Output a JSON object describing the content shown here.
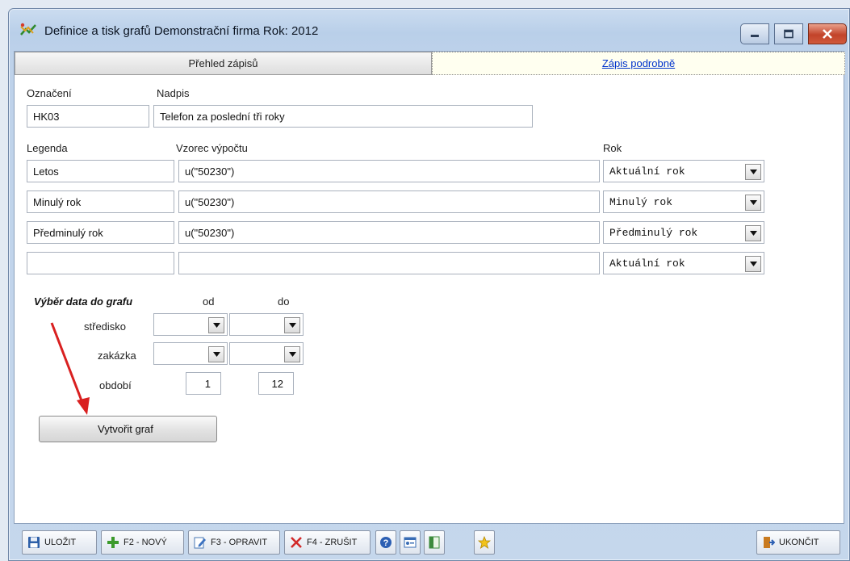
{
  "window": {
    "title": "Definice a tisk grafů  Demonstrační firma  Rok: 2012"
  },
  "tabs": [
    {
      "label": "Přehled zápisů",
      "active": false
    },
    {
      "label": "Zápis podrobně",
      "active": true
    }
  ],
  "form": {
    "oznaceni_label": "Označení",
    "oznaceni_value": "HK03",
    "nadpis_label": "Nadpis",
    "nadpis_value": "Telefon za poslední tři roky",
    "legenda_header": "Legenda",
    "vzorec_header": "Vzorec výpočtu",
    "rok_header": "Rok",
    "rows": [
      {
        "legenda": "Letos",
        "vzorec": "u(\"50230\")",
        "rok": "Aktuální rok"
      },
      {
        "legenda": "Minulý rok",
        "vzorec": "u(\"50230\")",
        "rok": "Minulý rok"
      },
      {
        "legenda": "Předminulý rok",
        "vzorec": "u(\"50230\")",
        "rok": "Předminulý rok"
      },
      {
        "legenda": "",
        "vzorec": "",
        "rok": "Aktuální rok"
      }
    ]
  },
  "selection": {
    "title": "Výběr data do grafu",
    "from_label": "od",
    "to_label": "do",
    "stredisko_label": "středisko",
    "zakazka_label": "zakázka",
    "obdobi_label": "období",
    "stredisko_from": "",
    "stredisko_to": "",
    "zakazka_from": "",
    "zakazka_to": "",
    "obdobi_from": "1",
    "obdobi_to": "12"
  },
  "create_button": "Vytvořit graf",
  "toolbar": {
    "save": "ULOŽIT",
    "new": "F2 - NOVÝ",
    "edit": "F3 - OPRAVIT",
    "delete": "F4 - ZRUŠIT",
    "exit": "UKONČIT"
  },
  "colors": {
    "link": "#0033cc",
    "arrow": "#d92020",
    "close_button": "#c2432a"
  }
}
